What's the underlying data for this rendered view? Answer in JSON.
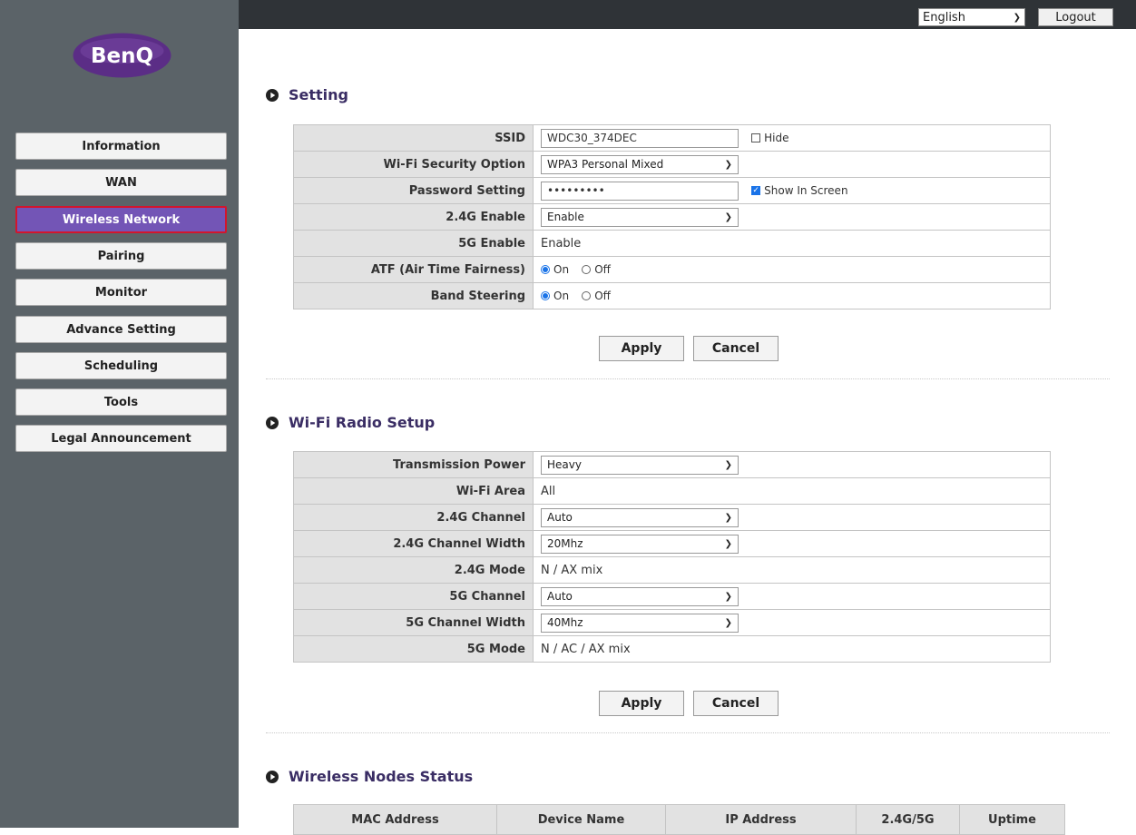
{
  "brand": {
    "logo_text": "BenQ",
    "logo_color": "#5b2d86"
  },
  "header": {
    "language": "English",
    "logout_label": "Logout"
  },
  "sidebar": {
    "items": [
      {
        "label": "Information"
      },
      {
        "label": "WAN"
      },
      {
        "label": "Wireless Network",
        "active": true
      },
      {
        "label": "Pairing"
      },
      {
        "label": "Monitor"
      },
      {
        "label": "Advance Setting"
      },
      {
        "label": "Scheduling"
      },
      {
        "label": "Tools"
      },
      {
        "label": "Legal Announcement"
      }
    ]
  },
  "setting": {
    "title": "Setting",
    "ssid": {
      "label": "SSID",
      "value": "WDC30_374DEC",
      "hide_label": "Hide",
      "hide_checked": false
    },
    "security": {
      "label": "Wi-Fi Security Option",
      "value": "WPA3 Personal Mixed"
    },
    "password": {
      "label": "Password Setting",
      "value": "•••••••••",
      "show_label": "Show In Screen",
      "show_checked": true
    },
    "g24_enable": {
      "label": "2.4G Enable",
      "value": "Enable"
    },
    "g5_enable": {
      "label": "5G Enable",
      "value": "Enable"
    },
    "atf": {
      "label": "ATF (Air Time Fairness)",
      "on_label": "On",
      "off_label": "Off",
      "selected": "On"
    },
    "band": {
      "label": "Band Steering",
      "on_label": "On",
      "off_label": "Off",
      "selected": "On"
    },
    "apply_label": "Apply",
    "cancel_label": "Cancel"
  },
  "radio": {
    "title": "Wi-Fi Radio Setup",
    "power": {
      "label": "Transmission Power",
      "value": "Heavy"
    },
    "area": {
      "label": "Wi-Fi Area",
      "value": "All"
    },
    "ch24": {
      "label": "2.4G Channel",
      "value": "Auto"
    },
    "w24": {
      "label": "2.4G Channel Width",
      "value": "20Mhz"
    },
    "m24": {
      "label": "2.4G Mode",
      "value": "N / AX mix"
    },
    "ch5": {
      "label": "5G Channel",
      "value": "Auto"
    },
    "w5": {
      "label": "5G Channel Width",
      "value": "40Mhz"
    },
    "m5": {
      "label": "5G Mode",
      "value": "N / AC / AX mix"
    },
    "apply_label": "Apply",
    "cancel_label": "Cancel"
  },
  "nodes": {
    "title": "Wireless Nodes Status",
    "columns": [
      "MAC Address",
      "Device Name",
      "IP Address",
      "2.4G/5G",
      "Uptime"
    ]
  },
  "colors": {
    "accent": "#7355b6",
    "sidebar": "#5b6368",
    "topbar": "#2f3337",
    "heading": "#3a2d64"
  }
}
